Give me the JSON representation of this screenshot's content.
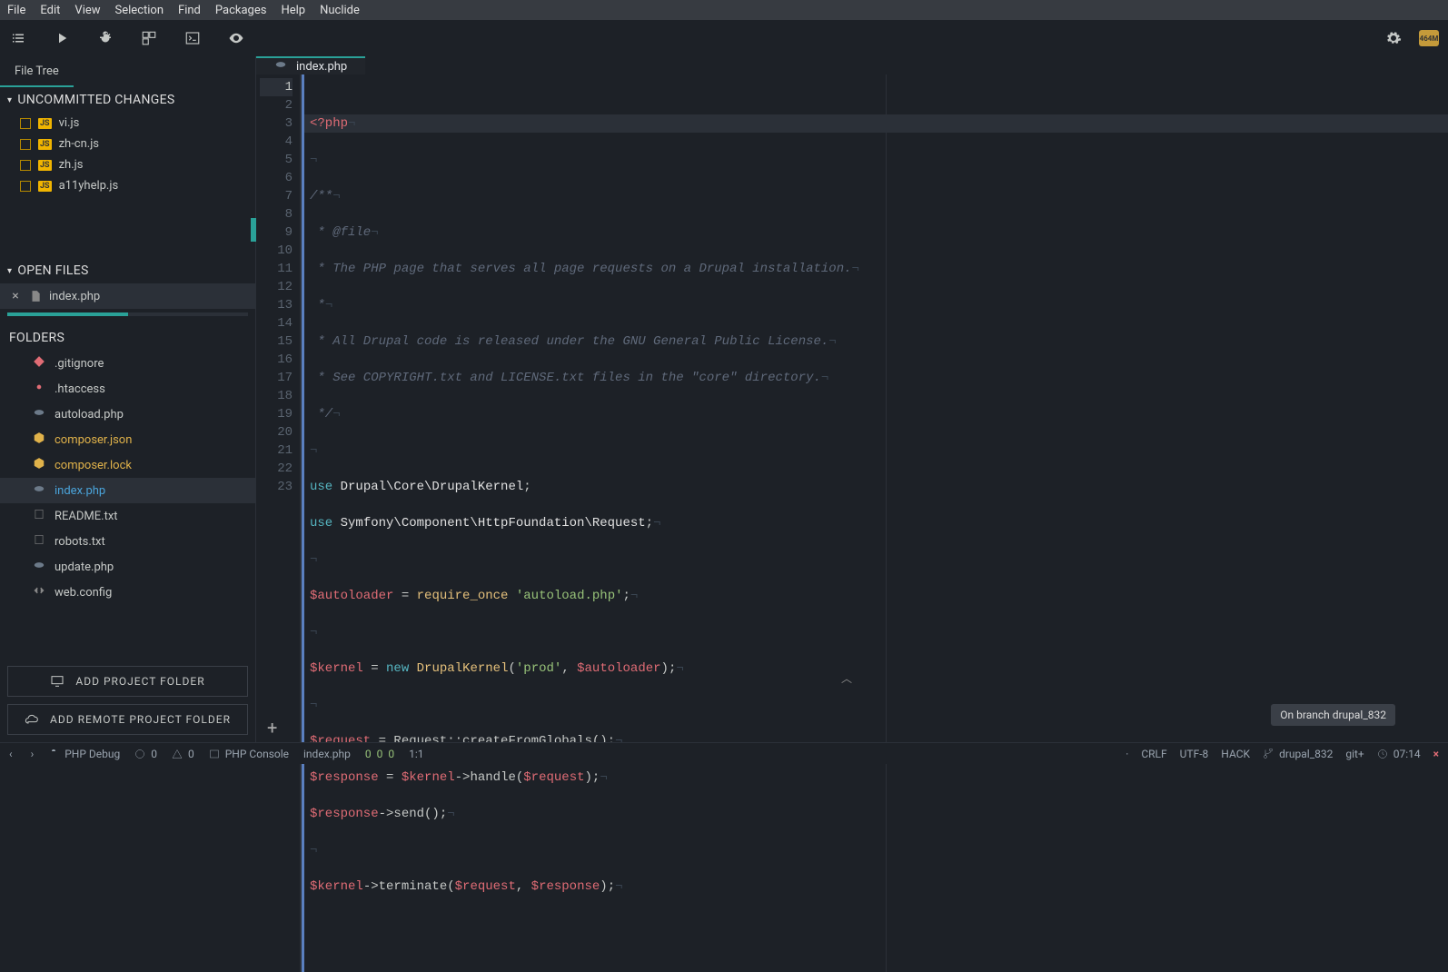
{
  "menubar": [
    "File",
    "Edit",
    "View",
    "Selection",
    "Find",
    "Packages",
    "Help",
    "Nuclide"
  ],
  "sidebar": {
    "tab": "File Tree",
    "uncommitted_header": "UNCOMMITTED CHANGES",
    "uncommitted": [
      "vi.js",
      "zh-cn.js",
      "zh.js",
      "a11yhelp.js"
    ],
    "open_header": "OPEN FILES",
    "open_files": [
      "index.php"
    ],
    "folders_header": "FOLDERS",
    "folders": [
      {
        "name": ".gitignore",
        "icon": "git",
        "color": ""
      },
      {
        "name": ".htaccess",
        "icon": "gear",
        "color": ""
      },
      {
        "name": "autoload.php",
        "icon": "php",
        "color": ""
      },
      {
        "name": "composer.json",
        "icon": "pkg",
        "color": "yellow"
      },
      {
        "name": "composer.lock",
        "icon": "pkg",
        "color": "yellow"
      },
      {
        "name": "index.php",
        "icon": "php",
        "color": "selected"
      },
      {
        "name": "README.txt",
        "icon": "txt",
        "color": ""
      },
      {
        "name": "robots.txt",
        "icon": "txt",
        "color": ""
      },
      {
        "name": "update.php",
        "icon": "php",
        "color": ""
      },
      {
        "name": "web.config",
        "icon": "code",
        "color": ""
      }
    ],
    "btn_add": "ADD PROJECT FOLDER",
    "btn_add_remote": "ADD REMOTE PROJECT FOLDER"
  },
  "tabs": [
    {
      "label": "index.php"
    }
  ],
  "code_lines": 23,
  "status": {
    "debug": "PHP Debug",
    "err0": "0",
    "warn0": "0",
    "console": "PHP Console",
    "file": "index.php",
    "nums": [
      "0",
      "0",
      "0"
    ],
    "cursor": "1:1",
    "lineend": "CRLF",
    "encoding": "UTF-8",
    "grammar": "HACK",
    "branch": "drupal_832",
    "git": "git+",
    "time": "07:14",
    "mem": "464M"
  },
  "tooltip": "On branch drupal_832"
}
